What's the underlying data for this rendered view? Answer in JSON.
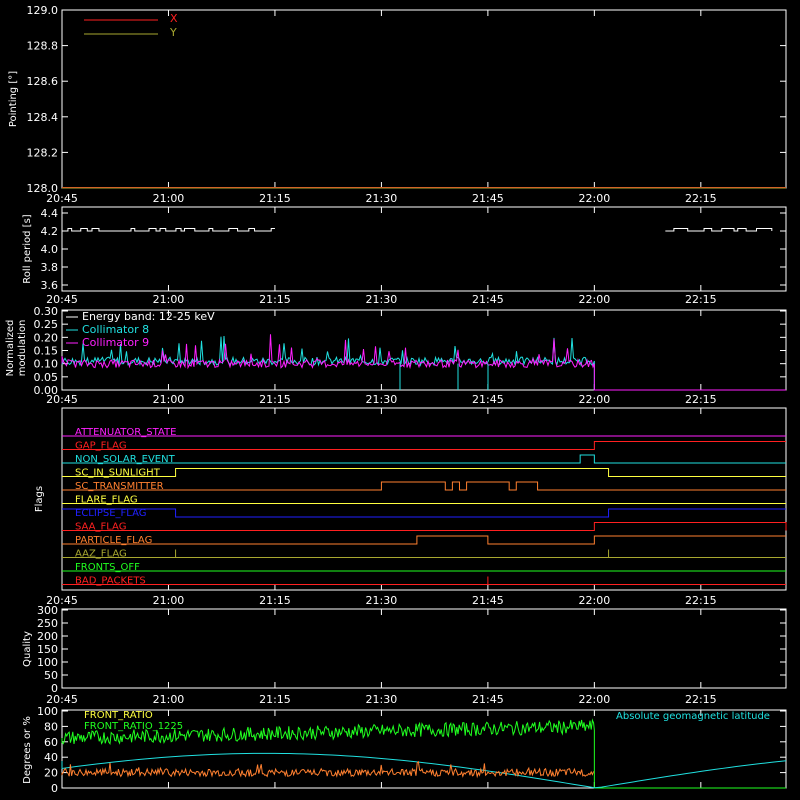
{
  "times": [
    "20:45",
    "21:00",
    "21:15",
    "21:30",
    "21:45",
    "22:00",
    "22:15"
  ],
  "colors": {
    "axis": "#ffffff",
    "red": "#ff2020",
    "olive": "#a8a830",
    "cyan": "#20e0e0",
    "magenta": "#ff20ff",
    "yellow": "#ffff40",
    "orange": "#ff8030",
    "blue": "#2020ff",
    "green": "#20ff20",
    "olive2": "#8a8a20"
  },
  "chart_data": [
    {
      "id": "pointing",
      "type": "line",
      "ylabel": "Pointing [°]",
      "ylim": [
        128.0,
        129.0
      ],
      "yticks": [
        "129.0",
        "128.8",
        "128.6",
        "128.4",
        "128.2",
        "128.0"
      ],
      "legend": [
        "X",
        "Y"
      ],
      "series": [
        {
          "name": "X",
          "values": [
            128.0,
            128.0
          ]
        },
        {
          "name": "Y",
          "values": [
            128.0,
            128.0
          ]
        }
      ]
    },
    {
      "id": "roll",
      "type": "line",
      "ylabel": "Roll period [s]",
      "ylim": [
        3.5,
        4.5
      ],
      "yticks": [
        "4.4",
        "4.2",
        "4.0",
        "3.8",
        "3.6"
      ],
      "segments": [
        [
          "20:45",
          "21:15",
          4.2
        ],
        [
          "22:10",
          "22:25",
          4.2
        ]
      ]
    },
    {
      "id": "modulation",
      "type": "line",
      "ylabel": "Normalized modulation",
      "ylim": [
        0.0,
        0.3
      ],
      "yticks": [
        "0.30",
        "0.25",
        "0.20",
        "0.15",
        "0.10",
        "0.05",
        "0.00"
      ],
      "legend": [
        "Energy band: 12-25 keV",
        "Collimator 8",
        "Collimator 9"
      ],
      "series": [
        {
          "name": "Collimator 8",
          "baseline": 0.11,
          "end_time": "22:00"
        },
        {
          "name": "Collimator 9",
          "baseline": 0.1,
          "end_time": "22:00"
        }
      ],
      "after_value": 0.0
    },
    {
      "id": "flags",
      "type": "line",
      "ylabel": "Flags",
      "flags": [
        {
          "name": "ATTENUATOR_STATE",
          "color": "magenta",
          "transitions": []
        },
        {
          "name": "GAP_FLAG",
          "color": "red",
          "transitions": [
            [
              "22:00",
              1
            ]
          ]
        },
        {
          "name": "NON_SOLAR_EVENT",
          "color": "cyan",
          "transitions": [
            [
              "21:58",
              1
            ],
            [
              "22:00",
              0
            ]
          ]
        },
        {
          "name": "SC_IN_SUNLIGHT",
          "color": "yellow",
          "transitions": [
            [
              "21:01",
              1
            ],
            [
              "22:02",
              0
            ]
          ]
        },
        {
          "name": "SC_TRANSMITTER",
          "color": "orange",
          "transitions": [
            [
              "21:30",
              1
            ],
            [
              "21:39",
              0
            ],
            [
              "21:40",
              1
            ],
            [
              "21:41",
              0
            ],
            [
              "21:42",
              1
            ],
            [
              "21:48",
              0
            ],
            [
              "21:49",
              1
            ],
            [
              "21:52",
              0
            ]
          ]
        },
        {
          "name": "FLARE_FLAG",
          "color": "yellow",
          "transitions": []
        },
        {
          "name": "ECLIPSE_FLAG",
          "color": "blue",
          "transitions": [
            [
              "21:01",
              0
            ],
            [
              "22:02",
              1
            ]
          ]
        },
        {
          "name": "SAA_FLAG",
          "color": "red",
          "transitions": [
            [
              "22:00",
              1
            ],
            [
              "22:27",
              0
            ]
          ]
        },
        {
          "name": "PARTICLE_FLAG",
          "color": "orange",
          "transitions": [
            [
              "21:35",
              1
            ],
            [
              "21:45",
              0
            ],
            [
              "22:00",
              1
            ]
          ]
        },
        {
          "name": "AAZ_FLAG",
          "color": "olive",
          "transitions": [
            [
              "21:01",
              1
            ],
            [
              "21:01",
              0
            ],
            [
              "22:02",
              1
            ],
            [
              "22:02",
              0
            ]
          ]
        },
        {
          "name": "FRONTS_OFF",
          "color": "green",
          "transitions": []
        },
        {
          "name": "BAD_PACKETS",
          "color": "red",
          "transitions": [
            [
              "21:45",
              1
            ],
            [
              "21:45",
              0
            ]
          ]
        }
      ]
    },
    {
      "id": "quality",
      "type": "line",
      "ylabel": "Quality",
      "ylim": [
        0,
        300
      ],
      "yticks": [
        "300",
        "250",
        "200",
        "150",
        "100",
        "50",
        "0"
      ]
    },
    {
      "id": "front",
      "type": "line",
      "ylabel": "Degrees or %",
      "ylim": [
        0,
        100
      ],
      "yticks": [
        "100",
        "80",
        "60",
        "40",
        "20",
        "0"
      ],
      "legend": [
        "FRONT_RATIO",
        "FRONT_RATIO_1225",
        "Absolute geomagnetic latitude"
      ],
      "series": [
        {
          "name": "FRONT_RATIO",
          "baseline": 75,
          "end_time": "22:00"
        },
        {
          "name": "FRONT_RATIO_1225",
          "baseline": 20,
          "end_time": "22:00"
        },
        {
          "name": "Absolute geomagnetic latitude",
          "amplitude": 45
        }
      ]
    }
  ]
}
